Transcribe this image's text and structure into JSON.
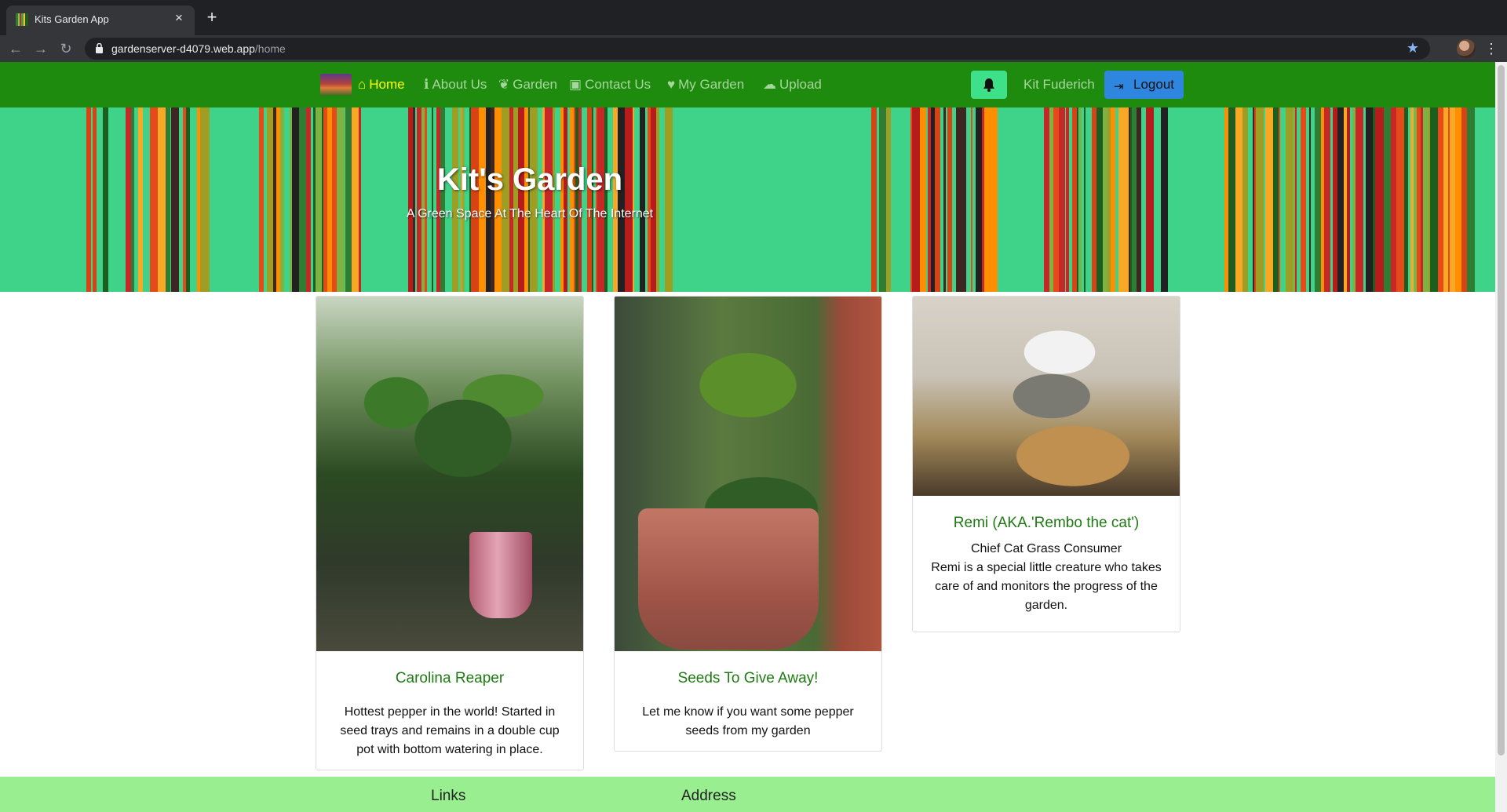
{
  "browser": {
    "tab_title": "Kits Garden App",
    "tab_close": "×",
    "new_tab": "+",
    "url_host": "gardenserver-d4079.web.app",
    "url_path": "/home",
    "back": "←",
    "forward": "→",
    "reload": "↻",
    "star": "★",
    "menu": "⋮"
  },
  "navbar": {
    "items": [
      {
        "label": "Home",
        "icon": "home-icon",
        "glyph": "⌂",
        "active": true
      },
      {
        "label": "About Us",
        "icon": "info-icon",
        "glyph": "ℹ"
      },
      {
        "label": "Garden",
        "icon": "leaf-icon",
        "glyph": "❦"
      },
      {
        "label": "Contact Us",
        "icon": "address-card-icon",
        "glyph": "▣"
      },
      {
        "label": "My Garden",
        "icon": "heart-icon",
        "glyph": "♥"
      },
      {
        "label": "Upload",
        "icon": "cloud-upload-icon",
        "glyph": "☁"
      }
    ],
    "username": "Kit Fuderich",
    "logout_label": "Logout",
    "logout_glyph": "⇥",
    "active_color": "#ffff00",
    "background": "#1e8a0e"
  },
  "hero": {
    "title": "Kit's Garden",
    "subtitle": "A Green Space At The Heart Of The Internet",
    "background": "#3fd38a"
  },
  "cards": [
    {
      "title": "Carolina Reaper",
      "text": "Hottest pepper in the world! Started in seed trays and remains in a double cup pot with bottom watering in place."
    },
    {
      "title": "Seeds To Give Away!",
      "text": "Let me know if you want some pepper seeds from my garden"
    },
    {
      "title": "Remi (AKA.'Rembo the cat')",
      "subtitle": "Chief Cat Grass Consumer",
      "text": "Remi is a special little creature who takes care of and monitors the progress of the garden."
    }
  ],
  "footer": {
    "links_heading": "Links",
    "address_heading": "Address",
    "background": "#99ee90"
  }
}
